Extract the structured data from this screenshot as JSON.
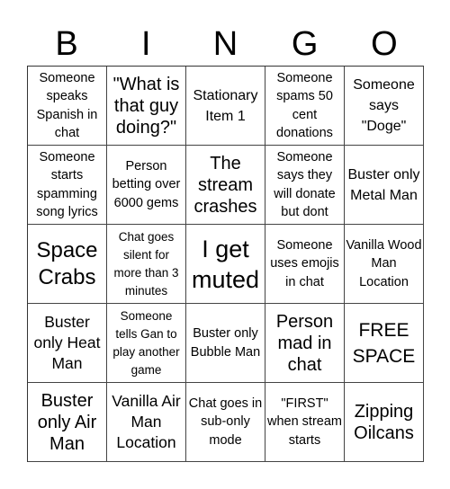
{
  "header": {
    "letters": [
      "B",
      "I",
      "N",
      "G",
      "O"
    ]
  },
  "cells": [
    [
      "Someone speaks Spanish in chat",
      "\"What is that guy doing?\"",
      "Stationary Item 1",
      "Someone spams 50 cent donations",
      "Someone says \"Doge\""
    ],
    [
      "Someone starts spamming song lyrics",
      "Person betting over 6000 gems",
      "The stream crashes",
      "Someone says they will donate but dont",
      "Buster only Metal Man"
    ],
    [
      "Space Crabs",
      "Chat goes silent for more than 3 minutes",
      "I get muted",
      "Someone uses emojis in chat",
      "Vanilla Wood Man Location"
    ],
    [
      "Buster only Heat Man",
      "Someone tells Gan to play another game",
      "Buster only Bubble Man",
      "Person mad in chat",
      "FREE SPACE"
    ],
    [
      "Buster only Air Man",
      "Vanilla Air Man Location",
      "Chat goes in sub-only mode",
      "\"FIRST\" when stream starts",
      "Zipping Oilcans"
    ]
  ]
}
